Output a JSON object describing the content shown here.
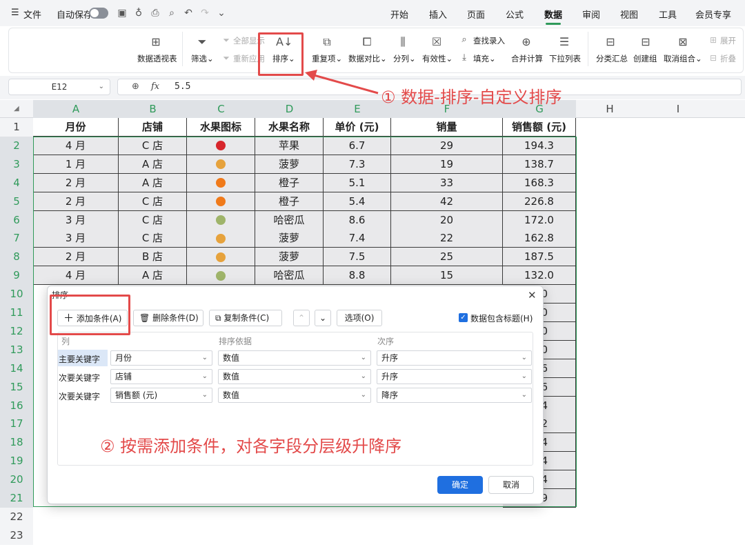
{
  "menu": {
    "hamburger_icon": "hamburger-icon",
    "file": "文件",
    "autosave": "自动保存",
    "tabs": [
      "开始",
      "插入",
      "页面",
      "公式",
      "数据",
      "审阅",
      "视图",
      "工具",
      "会员专享"
    ],
    "active_tab": "数据"
  },
  "ribbon": {
    "pivot": "数据透视表",
    "filter": "筛选",
    "show_all": "全部显示",
    "reapply": "重新应用",
    "sort": "排序",
    "duplicates": "重复项",
    "compare": "数据对比",
    "split": "分列",
    "validity": "有效性",
    "find_entry": "查找录入",
    "fill": "填充",
    "consolidate": "合并计算",
    "dropdown": "下拉列表",
    "subtotal": "分类汇总",
    "group": "创建组",
    "ungroup": "取消组合",
    "expand": "展开",
    "collapse": "折叠"
  },
  "formula_bar": {
    "cell_ref": "E12",
    "fx": "fx",
    "value": "5.5"
  },
  "columns": [
    "A",
    "B",
    "C",
    "D",
    "E",
    "F",
    "G",
    "H",
    "I"
  ],
  "rows": [
    "1",
    "2",
    "3",
    "4",
    "5",
    "6",
    "7",
    "8",
    "9",
    "10",
    "11",
    "12",
    "13",
    "14",
    "15",
    "16",
    "17",
    "18",
    "19",
    "20",
    "21",
    "22",
    "23"
  ],
  "table": {
    "headers": [
      "月份",
      "店铺",
      "水果图标",
      "水果名称",
      "单价 (元)",
      "销量",
      "销售额 (元)"
    ],
    "data": [
      [
        "4 月",
        "C 店",
        "apple",
        "苹果",
        "6.7",
        "29",
        "194.3"
      ],
      [
        "1 月",
        "A 店",
        "pineapple",
        "菠萝",
        "7.3",
        "19",
        "138.7"
      ],
      [
        "2 月",
        "A 店",
        "orange",
        "橙子",
        "5.1",
        "33",
        "168.3"
      ],
      [
        "2 月",
        "C 店",
        "orange",
        "橙子",
        "5.4",
        "42",
        "226.8"
      ],
      [
        "3 月",
        "C 店",
        "melon",
        "哈密瓜",
        "8.6",
        "20",
        "172.0"
      ],
      [
        "3 月",
        "C 店",
        "pineapple",
        "菠萝",
        "7.4",
        "22",
        "162.8"
      ],
      [
        "2 月",
        "B 店",
        "pineapple",
        "菠萝",
        "7.5",
        "25",
        "187.5"
      ],
      [
        "4 月",
        "A 店",
        "melon",
        "哈密瓜",
        "8.8",
        "15",
        "132.0"
      ]
    ],
    "right_fragments": [
      ".0",
      ".0",
      ".0",
      ".0",
      ".6",
      ".6",
      ".4",
      ".2",
      ".4",
      ".4",
      ".4",
      ".9"
    ]
  },
  "annotations": {
    "step1": "① 数据-排序-自定义排序",
    "step2": "② 按需添加条件，对各字段分层级升降序"
  },
  "dialog": {
    "title": "排序",
    "add": "添加条件(A)",
    "delete": "删除条件(D)",
    "copy": "复制条件(C)",
    "options": "选项(O)",
    "has_header": "数据包含标题(H)",
    "col_headers": [
      "列",
      "排序依据",
      "次序"
    ],
    "rules": [
      {
        "label": "主要关键字",
        "column": "月份",
        "basis": "数值",
        "order": "升序"
      },
      {
        "label": "次要关键字",
        "column": "店铺",
        "basis": "数值",
        "order": "升序"
      },
      {
        "label": "次要关键字",
        "column": "销售额 (元)",
        "basis": "数值",
        "order": "降序"
      }
    ],
    "ok": "确定",
    "cancel": "取消"
  },
  "colors": {
    "accent": "#2f9a5a",
    "callout": "#e34a4a",
    "primary_button": "#1f6fe0"
  }
}
